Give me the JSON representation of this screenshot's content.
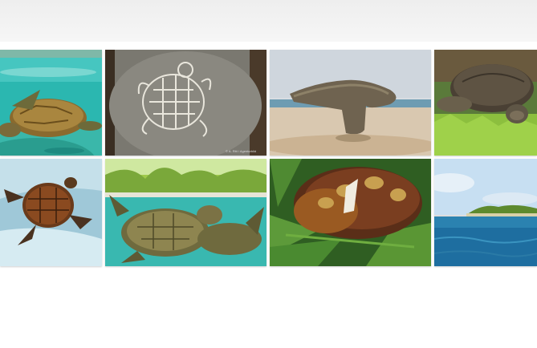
{
  "gallery": {
    "tiles": [
      {
        "subject": "green sea turtle swimming in turquoise water"
      },
      {
        "subject": "turtle petroglyph carved in stone",
        "credit": "© A. Ritt / Agenturbild"
      },
      {
        "subject": "mushroom-shaped rock on beach"
      },
      {
        "subject": "giant tortoise on grass"
      },
      {
        "subject": "hawksbill turtle seen from above"
      },
      {
        "subject": "green sea turtles on reef with palm shore"
      },
      {
        "subject": "cooked turtle on banana leaves"
      },
      {
        "subject": "tropical island across the ocean"
      }
    ]
  }
}
